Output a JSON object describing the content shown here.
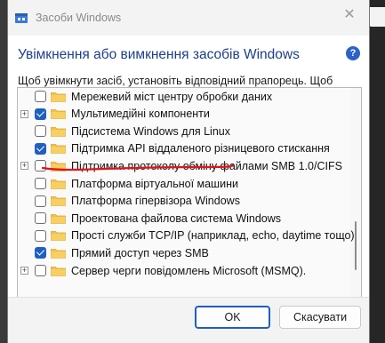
{
  "window": {
    "title": "Засоби Windows",
    "close_glyph": "✕"
  },
  "header": {
    "heading": "Увімкнення або вимкнення засобів Windows",
    "help_glyph": "?",
    "description": "Щоб увімкнути засіб, установіть відповідний прапорець. Щоб вимкнути засіб, зніміть відповідний прапорець. Зафарбоване поле прапорця означає часткове увімкнення засобу."
  },
  "features": [
    {
      "label": "Мережевий міст центру обробки даних",
      "expandable": false,
      "checked": false
    },
    {
      "label": "Мультимедійні компоненти",
      "expandable": true,
      "checked": true
    },
    {
      "label": "Підсистема Windows для Linux",
      "expandable": false,
      "checked": false,
      "highlighted": true
    },
    {
      "label": "Підтримка API віддаленого різницевого стискання",
      "expandable": false,
      "checked": true
    },
    {
      "label": "Підтримка протоколу обміну файлами SMB 1.0/CIFS",
      "expandable": true,
      "checked": false
    },
    {
      "label": "Платформа віртуальної машини",
      "expandable": false,
      "checked": false
    },
    {
      "label": "Платформа гіпервізора Windows",
      "expandable": false,
      "checked": false
    },
    {
      "label": "Проектована файлова система Windows",
      "expandable": false,
      "checked": false
    },
    {
      "label": "Прості служби TCP/IP (наприклад, echo, daytime тощо)",
      "expandable": false,
      "checked": false
    },
    {
      "label": "Прямий доступ через SMB",
      "expandable": false,
      "checked": true
    },
    {
      "label": "Сервер черги повідомлень Microsoft (MSMQ).",
      "expandable": true,
      "checked": false
    }
  ],
  "expander_glyph": "+",
  "buttons": {
    "ok": "OK",
    "cancel": "Скасувати"
  },
  "colors": {
    "accent": "#1f5fbf",
    "heading": "#1d3f8a",
    "annotation": "#e0141b",
    "folder": "#f2c14e"
  },
  "icons": {
    "app": "windows-features-icon",
    "help": "help-icon",
    "close": "close-icon",
    "folder": "folder-icon"
  }
}
